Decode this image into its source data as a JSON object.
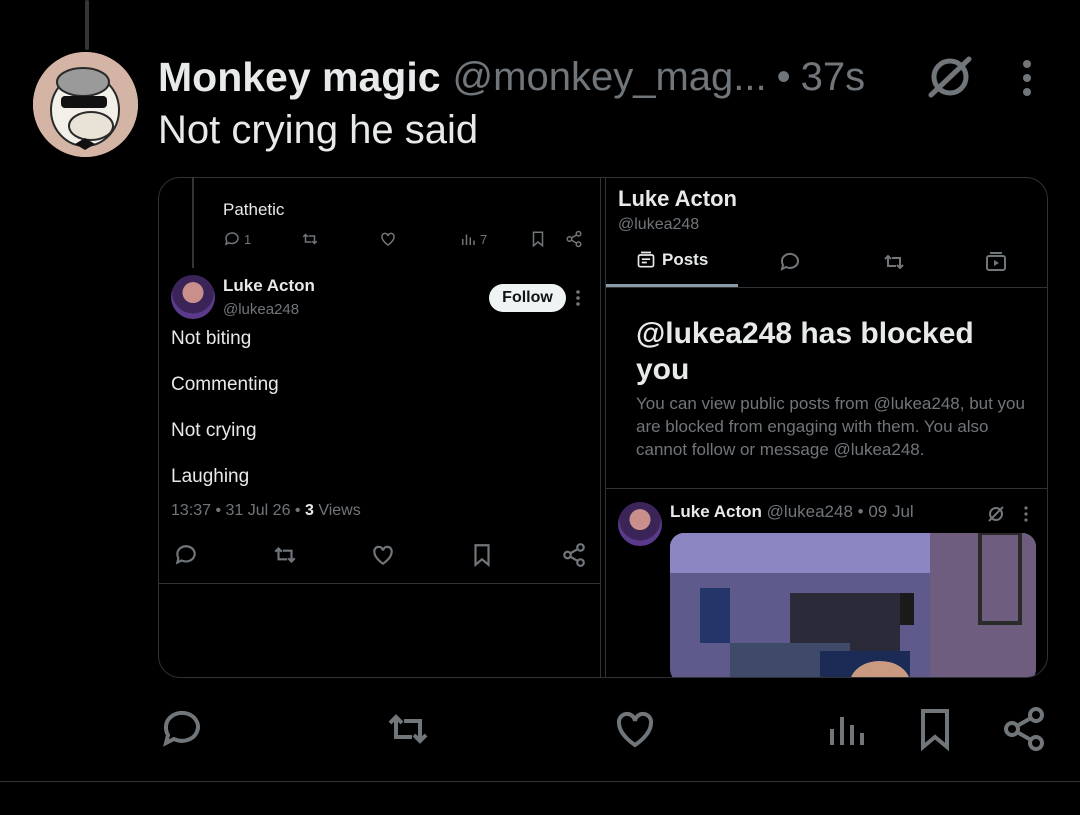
{
  "post": {
    "author_name": "Monkey magic",
    "author_handle": "@monkey_mag...",
    "separator": "•",
    "time": "37s",
    "text": "Not crying he said"
  },
  "left_screenshot": {
    "reply_text": "Pathetic",
    "reply_stats": {
      "replies": "1",
      "views": "7"
    },
    "author_name": "Luke Acton",
    "author_handle": "@lukea248",
    "follow_label": "Follow",
    "lines": [
      "Not biting",
      "Commenting",
      "Not crying",
      "Laughing"
    ],
    "meta_prefix": "13:37 • 31 Jul 26 • ",
    "meta_views_count": "3",
    "meta_views_label": " Views"
  },
  "right_screenshot": {
    "profile_name": "Luke Acton",
    "profile_handle": "@lukea248",
    "tab_posts_label": "Posts",
    "blocked_title": "@lukea248 has blocked you",
    "blocked_text": "You can view public posts from @lukea248, but you are blocked from engaging with them. You also cannot follow or message @lukea248.",
    "post_author": "Luke Acton",
    "post_handle_date": " @lukea248 • 09 Jul"
  },
  "icons": {
    "post_top": [
      "grok-icon",
      "more-icon"
    ],
    "bottom_bar": [
      "reply-icon",
      "repost-icon",
      "like-icon",
      "views-icon",
      "bookmark-icon",
      "share-icon"
    ]
  },
  "colors": {
    "background": "#000000",
    "text_primary": "#e7e9ea",
    "text_secondary": "#71767b",
    "border": "#2f3336"
  }
}
